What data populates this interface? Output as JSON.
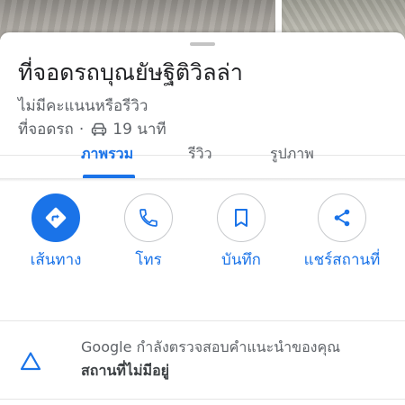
{
  "place": {
    "title": "ที่จอดรถบุณยัษฐิติวิลล่า",
    "rating_text": "ไม่มีคะแนนหรือรีวิว",
    "category": "ที่จอดรถ",
    "separator": "·",
    "drive_time": "19 นาที"
  },
  "tabs": [
    {
      "label": "ภาพรวม",
      "active": true
    },
    {
      "label": "รีวิว",
      "active": false
    },
    {
      "label": "รูปภาพ",
      "active": false
    }
  ],
  "actions": [
    {
      "label": "เส้นทาง",
      "icon": "directions-icon"
    },
    {
      "label": "โทร",
      "icon": "phone-icon"
    },
    {
      "label": "บันทึก",
      "icon": "bookmark-icon"
    },
    {
      "label": "แชร์สถานที่",
      "icon": "share-icon"
    }
  ],
  "notice": {
    "line1": "Google กำลังตรวจสอบคำแนะนำของคุณ",
    "line2": "สถานที่ไม่มีอยู่",
    "icon": "triangle-warning-icon"
  },
  "colors": {
    "accent": "#1a73e8",
    "secondary_text": "#5f6368",
    "primary_text": "#202124"
  }
}
